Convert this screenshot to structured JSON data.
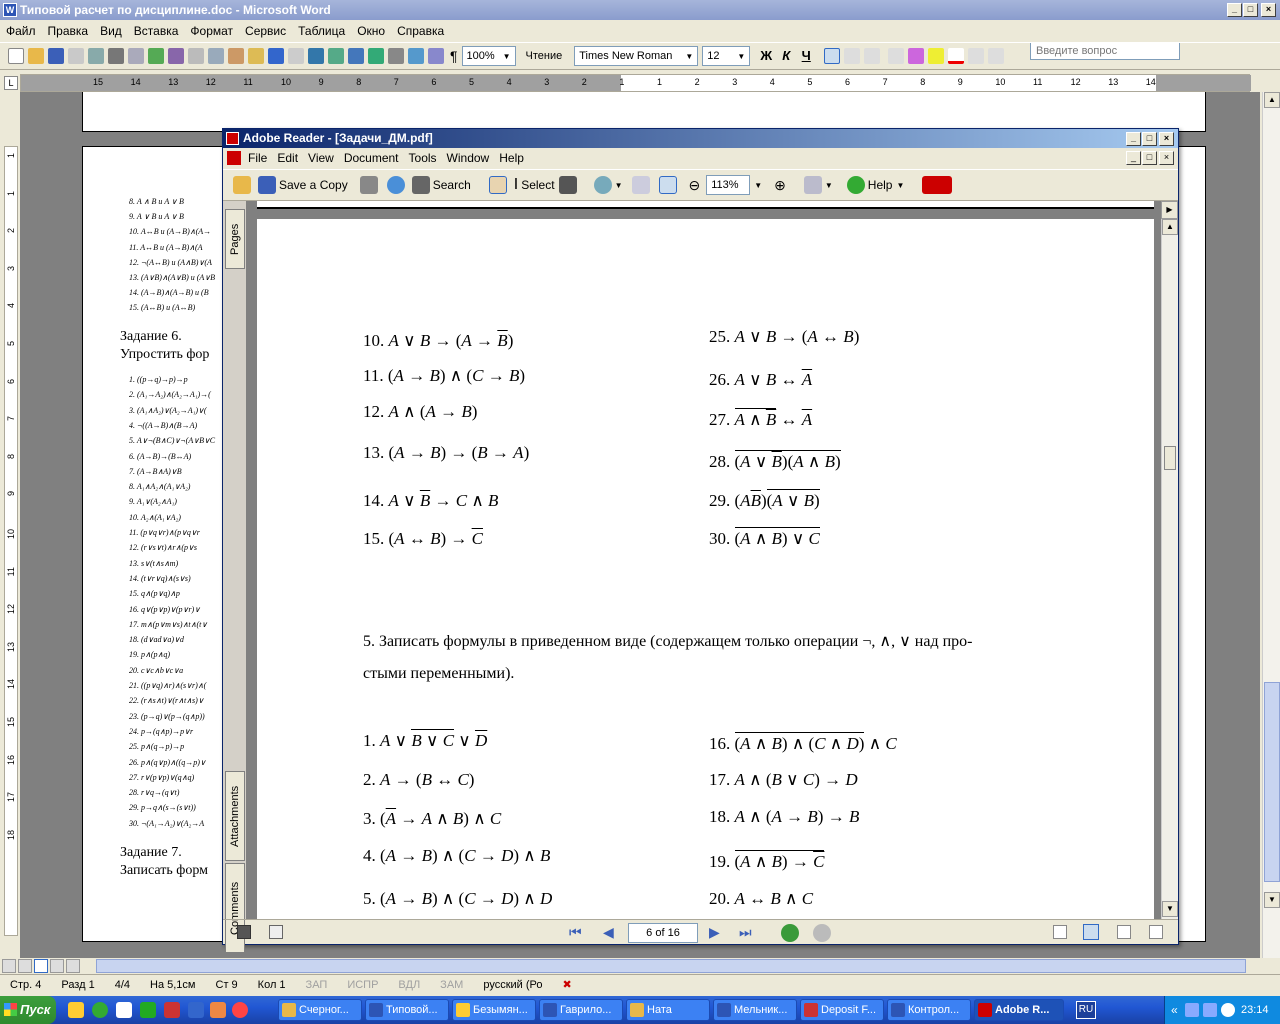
{
  "word": {
    "title": "Типовой расчет по дисциплине.doc - Microsoft Word",
    "menu": [
      "Файл",
      "Правка",
      "Вид",
      "Вставка",
      "Формат",
      "Сервис",
      "Таблица",
      "Окно",
      "Справка"
    ],
    "ask_placeholder": "Введите вопрос",
    "zoom": "100%",
    "reading": "Чтение",
    "font": "Times New Roman",
    "font_size": "12",
    "bold": "Ж",
    "italic": "К",
    "underline": "Ч",
    "ruler_labels": [
      "15",
      "14",
      "13",
      "12",
      "11",
      "10",
      "9",
      "8",
      "7",
      "6",
      "5",
      "4",
      "3",
      "2",
      "1",
      "1",
      "2",
      "3",
      "4",
      "5",
      "6",
      "7",
      "8",
      "9",
      "10",
      "11",
      "12",
      "13",
      "14"
    ],
    "vruler_labels": [
      "1",
      "1",
      "2",
      "3",
      "4",
      "5",
      "6",
      "7",
      "8",
      "9",
      "10",
      "11",
      "12",
      "13",
      "14",
      "15",
      "16",
      "17",
      "18"
    ],
    "page_text": {
      "task6": "Задание 6.",
      "task6_desc": "Упростить фор",
      "task7": "Задание 7.",
      "task7_desc": "Записать форм"
    },
    "small_lines_top": [
      "8. A ∧ B и A ∨ B",
      "9. A ∨ B и A ∨ B",
      "10. A↔B и (A→B)∧(A→",
      "11. A↔B и (A→B)∧(A",
      "12. ¬(A↔B) и (A∧B)∨(A",
      "13. (A∨B)∧(A∨B) и (A∨B",
      "14. (A→B)∧(A→B) и (B",
      "15. (A↔B) и (A↔B)"
    ],
    "small_lines_mid": [
      "1. ((p→q)→p)→p",
      "2. (A₁→A₂)∧(A₂→A₁)→(",
      "3. (A₁∧A₂)∨(A₂→A₁)∨(",
      "4. ¬((A→B)∧(B→A)",
      "5. A∨¬(B∧C)∨¬(A∨B∨C",
      "6. (A→B)→(B↔A)",
      "7. (A→B∧A)∨B",
      "8. A₁∧A₂∧(A₁∨A₂)",
      "9. A₁∨(A₂∧A₁)",
      "10. A₂∧(A₁∨A₂)",
      "11. (p∨q∨r)∧(p∨q∨r",
      "12. (r∨s∨t)∧r∧(p∨s",
      "13. s∨(t∧s∧m)",
      "14. (t∨r∨q)∧(s∨s)",
      "15. q∧(p∨q)∧p",
      "16. q∨(p∨p)∨(p∨r)∨",
      "17. m∧(p∨m∨s)∧t∧(t∨",
      "18. (d∨ad∨a)∨d",
      "19. p∧(p∧q)",
      "20. c∨c∧b∨c∨a",
      "21. ((p∨q)∧r)∧(s∨r)∧(",
      "22. (r∧s∧t)∨(r∧t∧s)∨",
      "23. (p→q)∨(p→(q∧p))",
      "24. p→(q∧p)→p∨r",
      "25. p∧(q→p)→p",
      "26. p∧(q∨p)∧((q→p)∨",
      "27. r∨(p∨p)∨(q∧q)",
      "28. r∨q→(q∨t)",
      "29. p→q∧(s→(s∨t))",
      "30. ¬(A₁→A₂)∨(A₂→A"
    ],
    "status": {
      "page": "Стр. 4",
      "section": "Разд 1",
      "pages": "4/4",
      "at": "На 5,1см",
      "line": "Ст 9",
      "col": "Кол 1",
      "rec": "ЗАП",
      "trk": "ИСПР",
      "ext": "ВДЛ",
      "ovr": "ЗАМ",
      "lang": "русский (Ро"
    }
  },
  "adobe": {
    "title": "Adobe Reader - [Задачи_ДМ.pdf]",
    "menu": [
      "File",
      "Edit",
      "View",
      "Document",
      "Tools",
      "Window",
      "Help"
    ],
    "save_copy": "Save a Copy",
    "search": "Search",
    "select": "Select",
    "zoom": "113%",
    "help": "Help",
    "tabs": {
      "pages": "Pages",
      "attachments": "Attachments",
      "comments": "Comments"
    },
    "page_nav": "6 of 16",
    "content": {
      "left1": [
        "10.",
        "11.",
        "12.",
        "13.",
        "14.",
        "15."
      ],
      "right1": [
        "25.",
        "26.",
        "27.",
        "28.",
        "29.",
        "30."
      ],
      "para_line1": "5. Записать формулы в приведенном виде (содержащем только операции  ¬, ∧, ∨ над про-",
      "para_line2": "стыми переменными).",
      "left2": [
        "1.",
        "2.",
        "3.",
        "4.",
        "5."
      ],
      "right2": [
        "16.",
        "17.",
        "18.",
        "19.",
        "20."
      ]
    }
  },
  "taskbar": {
    "start": "Пуск",
    "tasks": [
      "Счерног...",
      "Типовой...",
      "Безымян...",
      "Гаврило...",
      "Ната",
      "Мельник...",
      "Deposit F...",
      "Контрол...",
      "Adobe R..."
    ],
    "lang": "RU",
    "clock": "23:14"
  }
}
